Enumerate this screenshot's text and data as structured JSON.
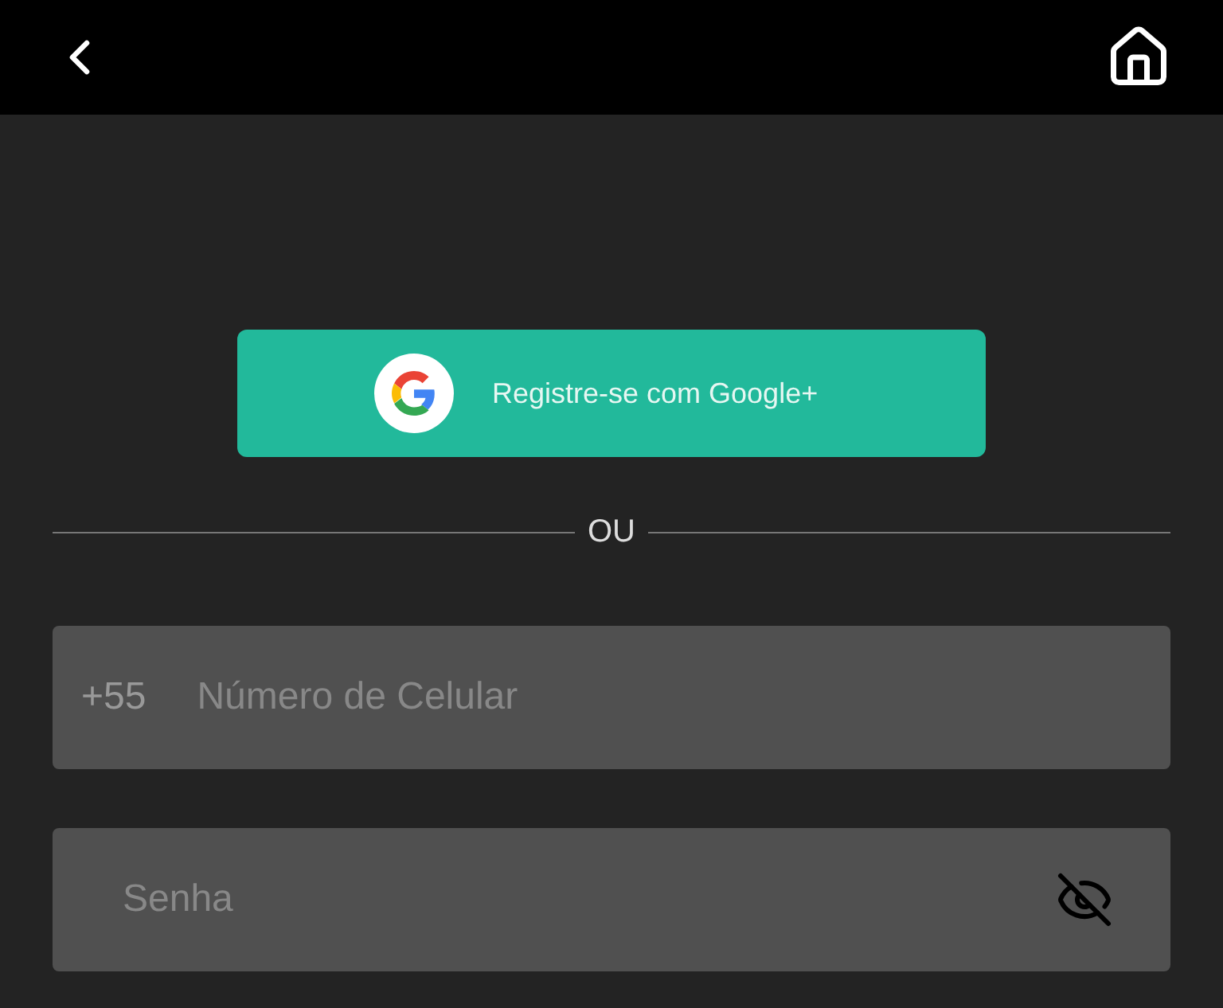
{
  "google_button": {
    "label": "Registre-se com Google+"
  },
  "divider": {
    "label": "OU"
  },
  "phone_field": {
    "prefix": "+55",
    "placeholder": "Número de Celular"
  },
  "password_field": {
    "placeholder": "Senha",
    "password_visible": false
  }
}
